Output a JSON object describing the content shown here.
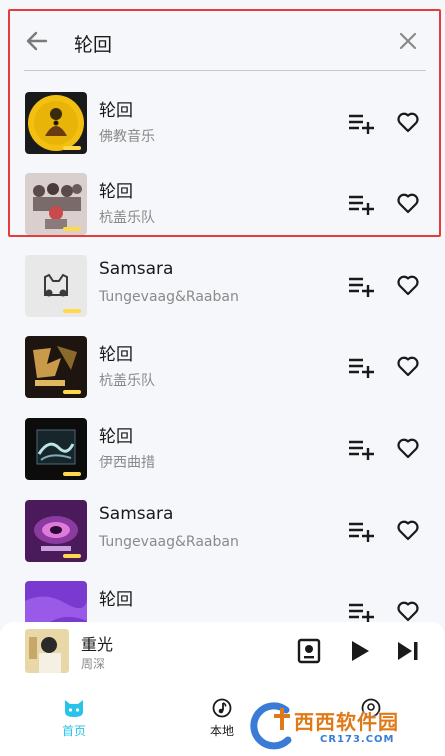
{
  "search": {
    "query": "轮回"
  },
  "songs": [
    {
      "title": "轮回",
      "artist": "佛教音乐"
    },
    {
      "title": "轮回",
      "artist": "杭盖乐队"
    },
    {
      "title": "Samsara",
      "artist": "Tungevaag&Raaban"
    },
    {
      "title": "轮回",
      "artist": "杭盖乐队"
    },
    {
      "title": "轮回",
      "artist": "伊西曲措"
    },
    {
      "title": "Samsara",
      "artist": "Tungevaag&Raaban"
    },
    {
      "title": "轮回",
      "artist": ""
    }
  ],
  "player": {
    "title": "重光",
    "artist": "周深"
  },
  "nav": {
    "home": "首页",
    "local": "本地"
  },
  "watermark": {
    "main": "西西软件园",
    "sub": "CR173.COM"
  },
  "colors": {
    "accent": "#29c2e8",
    "highlight": "#e63b3b"
  }
}
